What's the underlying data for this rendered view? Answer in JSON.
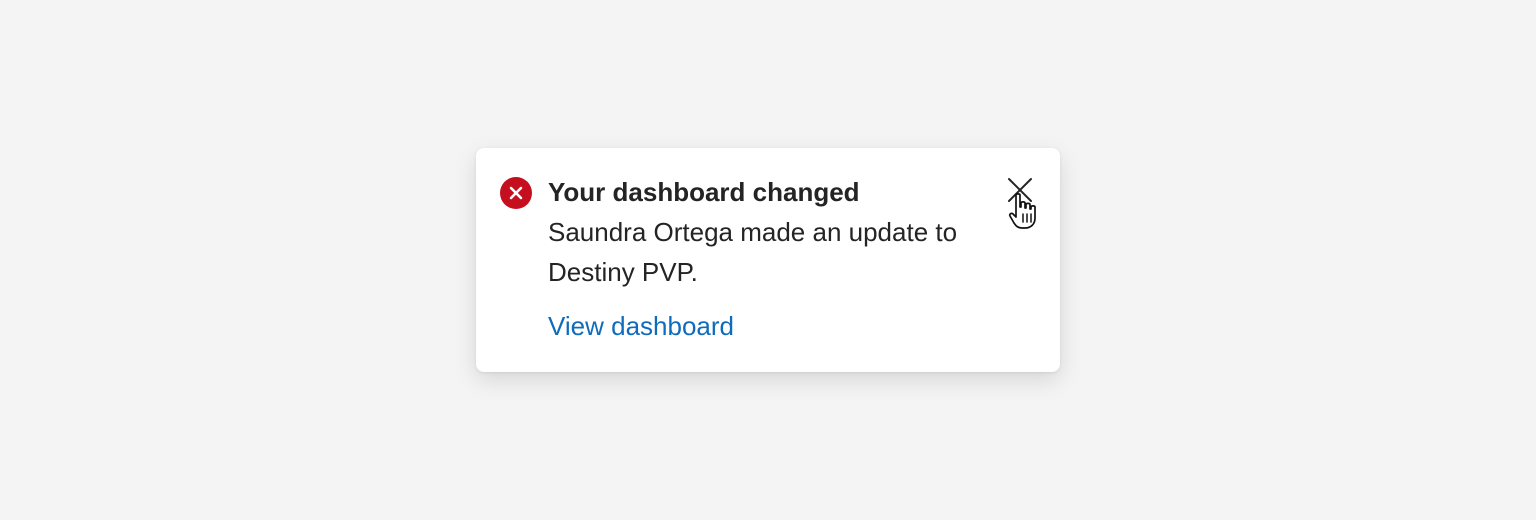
{
  "notification": {
    "title": "Your dashboard changed",
    "message": "Saundra Ortega made an update to Destiny PVP.",
    "action_label": "View dashboard",
    "status_icon": "error-circle-icon",
    "close_icon": "close-icon"
  },
  "colors": {
    "background": "#f4f4f4",
    "surface": "#ffffff",
    "text": "#242424",
    "link": "#0f6cbd",
    "error": "#c50f1f"
  }
}
